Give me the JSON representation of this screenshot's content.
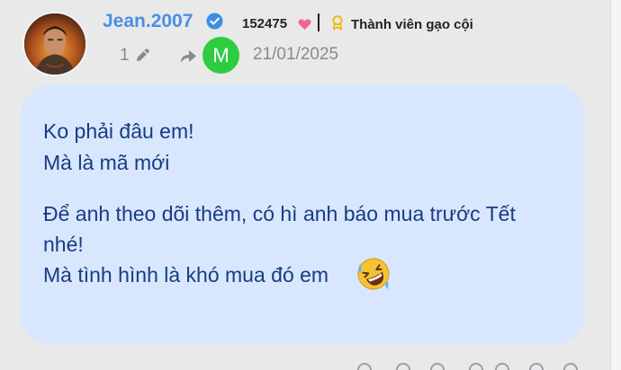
{
  "post": {
    "username": "Jean.2007",
    "points": "152475",
    "rank": "Thành viên gạo cội",
    "edit_count": "1",
    "reply_avatar_letter": "M",
    "date": "21/01/2025"
  },
  "message": {
    "lines": [
      "Ko phải đâu em!",
      "Mà là mã mới",
      "Để anh theo dõi thêm, có hì anh báo mua trước Tết",
      "nhé!",
      "Mà tình hình là khó mua đó em"
    ],
    "emoji": "rolling-on-floor-laughing"
  },
  "colors": {
    "username": "#4a8ee8",
    "bubble": "#d8e7fe",
    "message_text": "#183b83",
    "reply_avatar": "#2ecc40",
    "heart": "#f0688f",
    "medal": "#f2b600",
    "verified": "#3a8ee6",
    "background": "#e9e9e9"
  }
}
